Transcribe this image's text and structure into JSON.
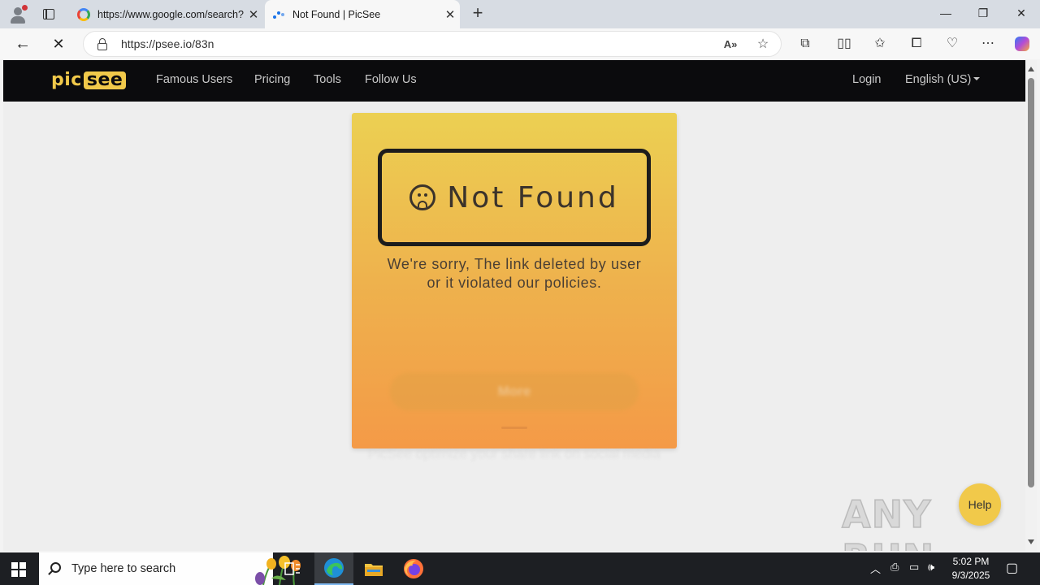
{
  "browser": {
    "tabs": [
      {
        "title": "https://www.google.com/search?q",
        "favicon": "google-icon"
      },
      {
        "title": "Not Found | PicSee",
        "favicon": "loading-icon"
      }
    ],
    "address": "https://psee.io/83n",
    "window_controls": {
      "minimize": "—",
      "restore": "❐",
      "close": "✕"
    }
  },
  "site": {
    "logo": {
      "pic": "pic",
      "see": "see"
    },
    "nav": [
      "Famous Users",
      "Pricing",
      "Tools",
      "Follow Us"
    ],
    "login": "Login",
    "language": "English (US)"
  },
  "card": {
    "heading": "Not Found",
    "message_line1": "We're sorry, The link deleted by user",
    "message_line2": "or it violated our policies.",
    "more_button": "More",
    "tagline": "PicSee optimize your share link on social media"
  },
  "help_button": "Help",
  "watermark": "ANY RUN",
  "taskbar": {
    "search_placeholder": "Type here to search",
    "time": "5:02 PM",
    "date": "9/3/2025"
  },
  "colors": {
    "site_nav_bg": "#0b0b0d",
    "brand_yellow": "#f1c94a",
    "card_top": "#ecd052",
    "card_bottom": "#f49a47"
  }
}
